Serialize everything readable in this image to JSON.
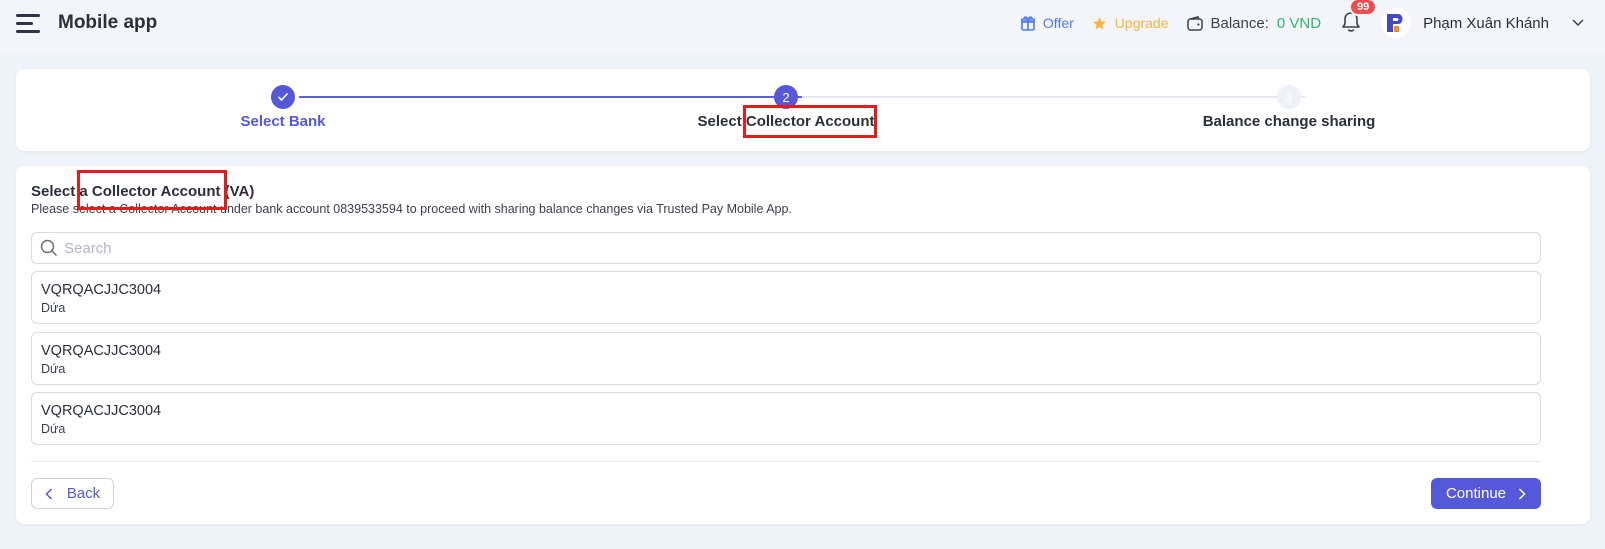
{
  "header": {
    "app_title": "Mobile app",
    "offer_label": "Offer",
    "upgrade_label": "Upgrade",
    "balance_label": "Balance:",
    "balance_amount": "0 VND",
    "notification_count": "99",
    "user_name": "Phạm Xuân Khánh"
  },
  "stepper": {
    "steps": [
      {
        "number": "1",
        "label": "Select Bank",
        "state": "completed"
      },
      {
        "number": "2",
        "label": "Select Collector Account",
        "state": "active"
      },
      {
        "number": "3",
        "label": "Balance change sharing",
        "state": "pending"
      }
    ]
  },
  "main": {
    "title": "Select a Collector Account (VA)",
    "description": "Please select a Collector Account under bank account 0839533594 to proceed with sharing balance changes via Trusted Pay Mobile App.",
    "search_placeholder": "Search",
    "accounts": [
      {
        "code": "VQRQACJJC3004",
        "name": "Dứa"
      },
      {
        "code": "VQRQACJJC3004",
        "name": "Dứa"
      },
      {
        "code": "VQRQACJJC3004",
        "name": "Dứa"
      }
    ],
    "back_label": "Back",
    "continue_label": "Continue"
  },
  "colors": {
    "primary": "#5558d9",
    "offer": "#4c78f0",
    "upgrade": "#f4b53b",
    "balance_amount": "#2fb86a",
    "badge": "#f04d4d",
    "highlight": "#e41b1b"
  }
}
